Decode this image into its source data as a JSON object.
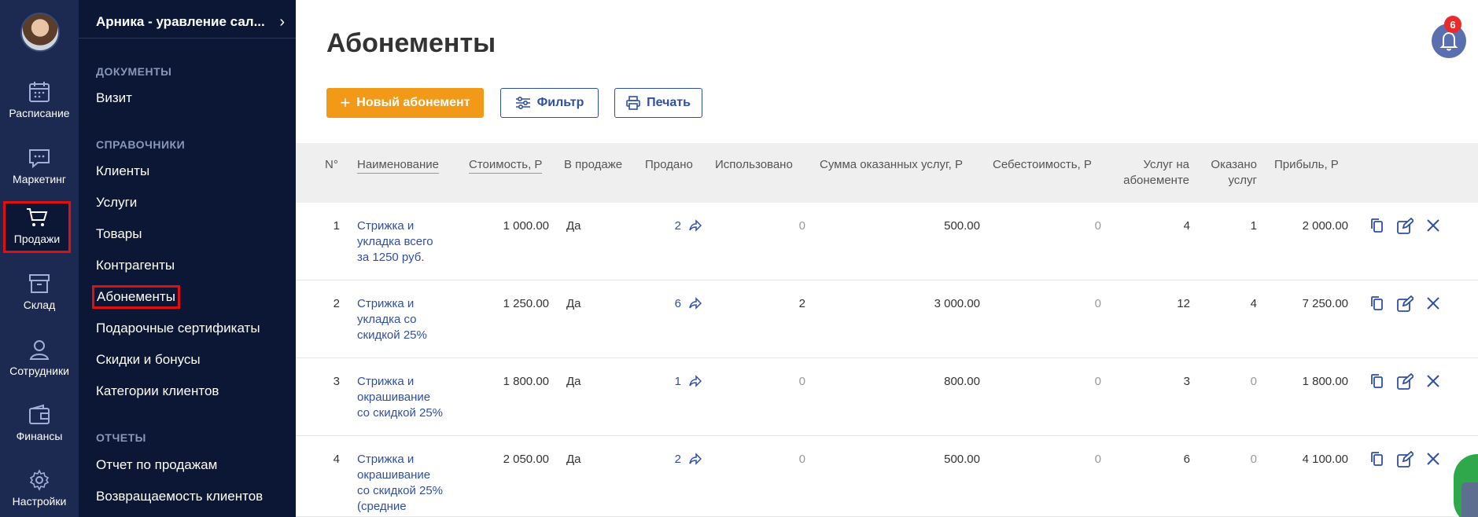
{
  "rail": {
    "items": [
      {
        "label": "Расписание",
        "icon": "calendar-icon"
      },
      {
        "label": "Маркетинг",
        "icon": "chat-icon"
      },
      {
        "label": "Продажи",
        "icon": "cart-icon"
      },
      {
        "label": "Склад",
        "icon": "box-icon"
      },
      {
        "label": "Сотрудники",
        "icon": "user-icon"
      },
      {
        "label": "Финансы",
        "icon": "wallet-icon"
      },
      {
        "label": "Настройки",
        "icon": "gear-icon"
      }
    ]
  },
  "sidebar": {
    "header": "Арника - уравление сал...",
    "sections": [
      {
        "title": "ДОКУМЕНТЫ",
        "items": [
          "Визит"
        ]
      },
      {
        "title": "СПРАВОЧНИКИ",
        "items": [
          "Клиенты",
          "Услуги",
          "Товары",
          "Контрагенты",
          "Абонементы",
          "Подарочные сертификаты",
          "Скидки и бонусы",
          "Категории клиентов"
        ]
      },
      {
        "title": "ОТЧЕТЫ",
        "items": [
          "Отчет по продажам",
          "Возвращаемость клиентов"
        ]
      }
    ]
  },
  "page": {
    "title": "Абонементы",
    "btn_new": "Новый абонемент",
    "btn_filter": "Фильтр",
    "btn_print": "Печать",
    "notifications": "6"
  },
  "table": {
    "headers": {
      "num": "N°",
      "name": "Наименование",
      "cost": "Стоимость, Р",
      "onsale": "В продаже",
      "sold": "Продано",
      "used": "Использовано",
      "sum": "Сумма оказанных услуг, Р",
      "selfcost": "Себестоимость, Р",
      "services1": "Услуг на",
      "services2": "абонементе",
      "rendered1": "Оказано",
      "rendered2": "услуг",
      "profit": "Прибыль, Р"
    },
    "rows": [
      {
        "n": "1",
        "name": [
          "Стрижка и",
          "укладка всего",
          "за 1250 руб."
        ],
        "cost": "1 000.00",
        "onsale": "Да",
        "sold": "2",
        "used": "0",
        "sum": "500.00",
        "selfcost": "0",
        "services": "4",
        "rendered": "1",
        "profit": "2 000.00"
      },
      {
        "n": "2",
        "name": [
          "Стрижка и",
          "укладка со",
          "скидкой 25%"
        ],
        "cost": "1 250.00",
        "onsale": "Да",
        "sold": "6",
        "used": "2",
        "sum": "3 000.00",
        "selfcost": "0",
        "services": "12",
        "rendered": "4",
        "profit": "7 250.00"
      },
      {
        "n": "3",
        "name": [
          "Стрижка и",
          "окрашивание",
          "со скидкой 25%"
        ],
        "cost": "1 800.00",
        "onsale": "Да",
        "sold": "1",
        "used": "0",
        "sum": "800.00",
        "selfcost": "0",
        "services": "3",
        "rendered": "0",
        "profit": "1 800.00"
      },
      {
        "n": "4",
        "name": [
          "Стрижка и",
          "окрашивание",
          "со скидкой 25%",
          "(средние"
        ],
        "cost": "2 050.00",
        "onsale": "Да",
        "sold": "2",
        "used": "0",
        "sum": "500.00",
        "selfcost": "0",
        "services": "6",
        "rendered": "0",
        "profit": "4 100.00"
      }
    ]
  },
  "colors": {
    "accent": "#f29a17",
    "link": "#2f4fa6",
    "rail": "#1c2a52",
    "sidebar": "#0c1635"
  }
}
